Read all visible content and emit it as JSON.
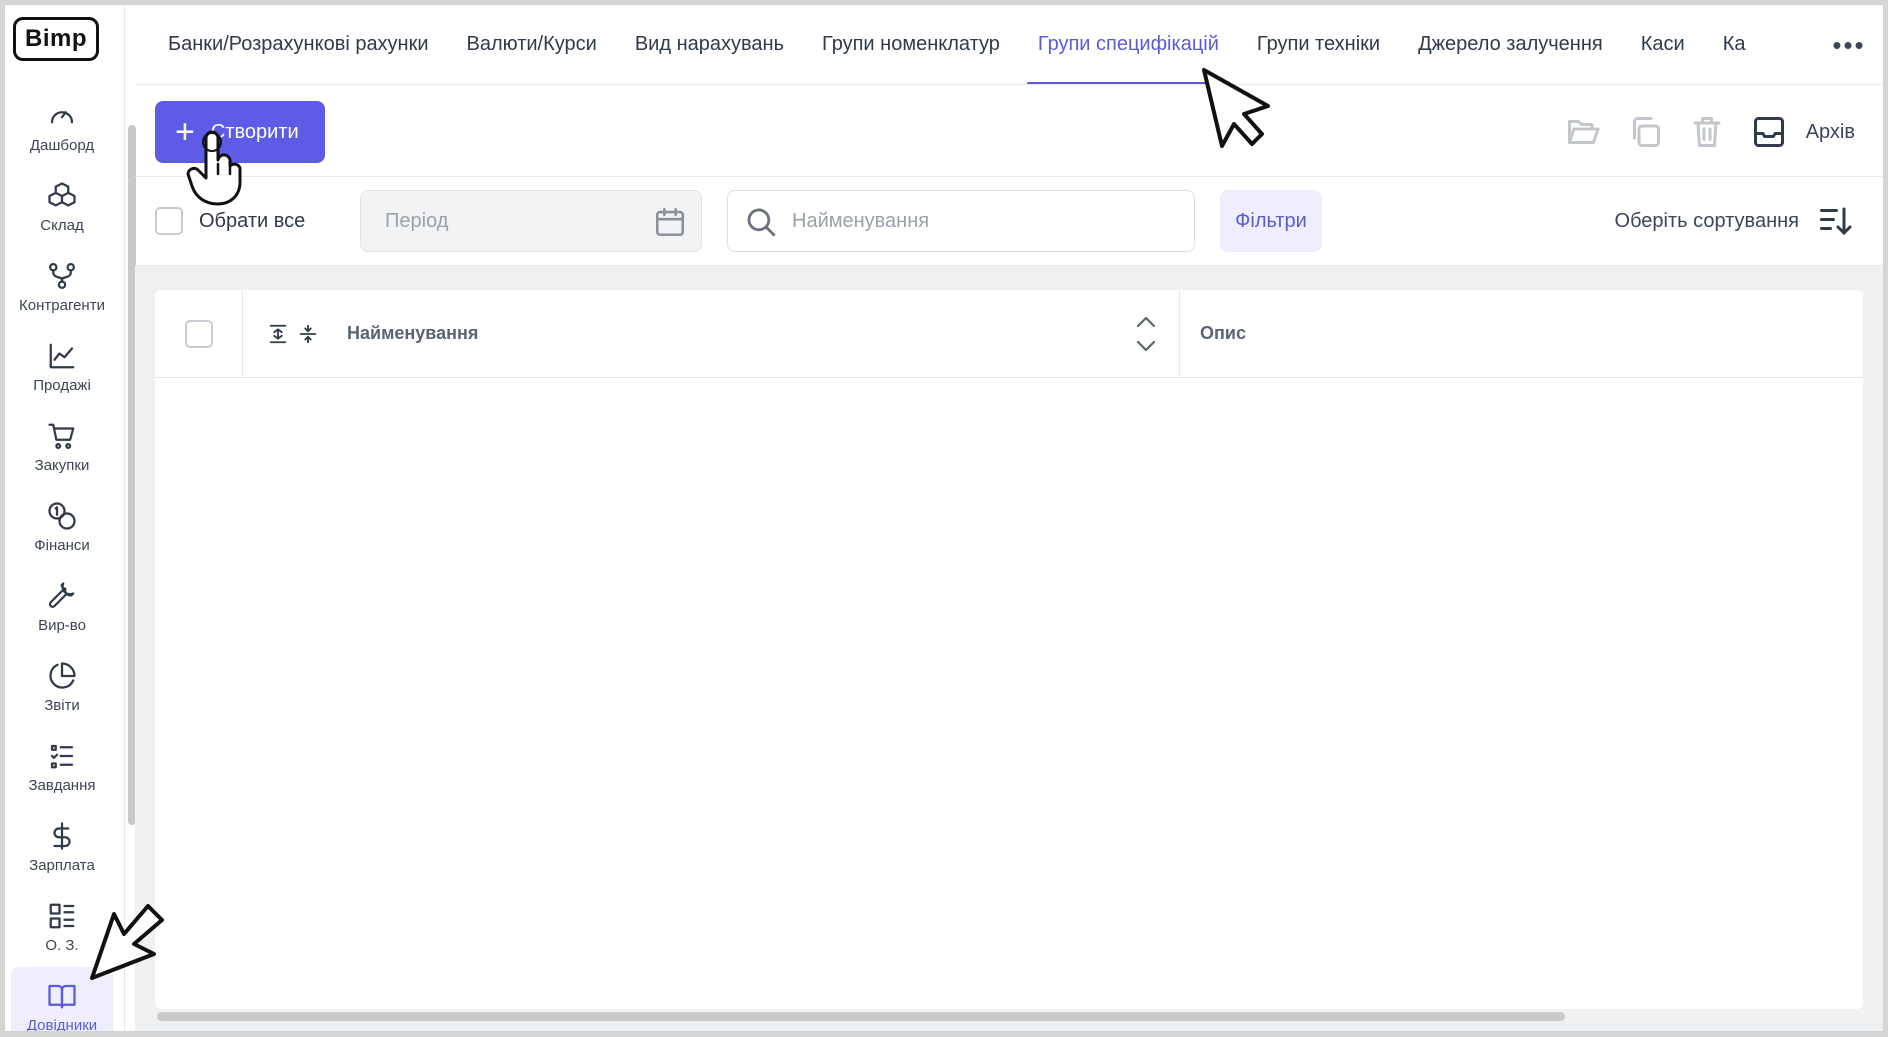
{
  "app": {
    "logo_text": "Bimp"
  },
  "sidebar": {
    "items": [
      {
        "label": "Дашборд",
        "icon": "gauge-icon"
      },
      {
        "label": "Склад",
        "icon": "boxes-icon"
      },
      {
        "label": "Контрагенти",
        "icon": "network-icon"
      },
      {
        "label": "Продажі",
        "icon": "line-chart-icon"
      },
      {
        "label": "Закупки",
        "icon": "cart-icon"
      },
      {
        "label": "Фінанси",
        "icon": "coins-icon"
      },
      {
        "label": "Вир-во",
        "icon": "wrench-icon"
      },
      {
        "label": "Звіти",
        "icon": "pie-chart-icon"
      },
      {
        "label": "Завдання",
        "icon": "checklist-icon"
      },
      {
        "label": "Зарплата",
        "icon": "dollar-icon"
      },
      {
        "label": "О. З.",
        "icon": "grid-list-icon"
      },
      {
        "label": "Довідники",
        "icon": "book-icon",
        "active": true
      }
    ]
  },
  "tabs": {
    "items": [
      {
        "label": "Банки/Розрахункові рахунки"
      },
      {
        "label": "Валюти/Курси"
      },
      {
        "label": "Вид нарахувань"
      },
      {
        "label": "Групи номенклатур"
      },
      {
        "label": "Групи специфікацій",
        "active": true
      },
      {
        "label": "Групи техніки"
      },
      {
        "label": "Джерело залучення"
      },
      {
        "label": "Каси"
      },
      {
        "label": "Ка"
      }
    ],
    "more_label": "•••"
  },
  "toolbar": {
    "create_label": "Створити",
    "archive_label": "Архів"
  },
  "filters": {
    "select_all_label": "Обрати все",
    "period_placeholder": "Період",
    "search_placeholder": "Найменування",
    "filters_label": "Фільтри",
    "sort_label": "Оберіть сортування"
  },
  "table": {
    "columns": [
      {
        "label": "Найменування"
      },
      {
        "label": "Опис"
      }
    ],
    "rows": []
  },
  "colors": {
    "accent": "#5e5ce6",
    "accent_light": "#eeeefc",
    "text": "#2f3a4a",
    "muted": "#9aa1ab",
    "background": "#f0f1f3"
  }
}
